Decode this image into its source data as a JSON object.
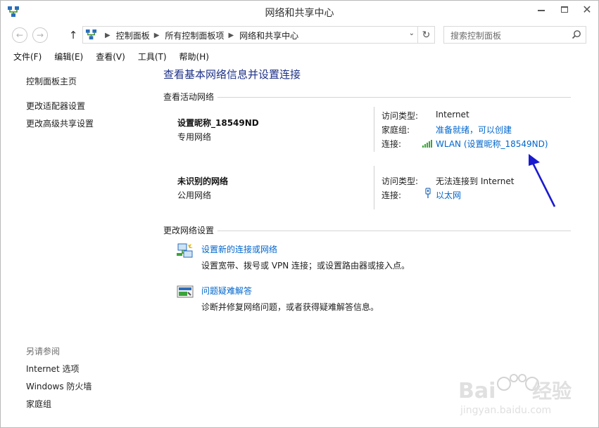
{
  "window": {
    "title": "网络和共享中心"
  },
  "address": {
    "crumbs": [
      "控制面板",
      "所有控制面板项",
      "网络和共享中心"
    ]
  },
  "search": {
    "placeholder": "搜索控制面板"
  },
  "menu": [
    "文件(F)",
    "编辑(E)",
    "查看(V)",
    "工具(T)",
    "帮助(H)"
  ],
  "sidebar": {
    "links": [
      "控制面板主页",
      "更改适配器设置",
      "更改高级共享设置"
    ],
    "see_also_title": "另请参阅",
    "see_also": [
      "Internet 选项",
      "Windows 防火墙",
      "家庭组"
    ]
  },
  "main": {
    "title": "查看基本网络信息并设置连接",
    "active_networks_heading": "查看活动网络",
    "networks": [
      {
        "name": "设置昵称_18549ND",
        "category": "专用网络",
        "access_label": "访问类型:",
        "access_value": "Internet",
        "homegroup_label": "家庭组:",
        "homegroup_value": "准备就绪，可以创建",
        "connection_label": "连接:",
        "connection_value": "WLAN (设置昵称_18549ND)",
        "connection_icon": "wifi-signal-icon"
      },
      {
        "name": "未识别的网络",
        "category": "公用网络",
        "access_label": "访问类型:",
        "access_value": "无法连接到 Internet",
        "connection_label": "连接:",
        "connection_value": "以太网",
        "connection_icon": "ethernet-icon"
      }
    ],
    "change_settings_heading": "更改网络设置",
    "tasks": [
      {
        "label": "设置新的连接或网络",
        "desc": "设置宽带、拨号或 VPN 连接；或设置路由器或接入点。",
        "icon": "new-connection-icon"
      },
      {
        "label": "问题疑难解答",
        "desc": "诊断并修复网络问题，或者获得疑难解答信息。",
        "icon": "troubleshoot-icon"
      }
    ]
  },
  "colors": {
    "link": "#0066cc",
    "title": "#1e3287",
    "annotation_arrow": "#1a1ad0"
  }
}
